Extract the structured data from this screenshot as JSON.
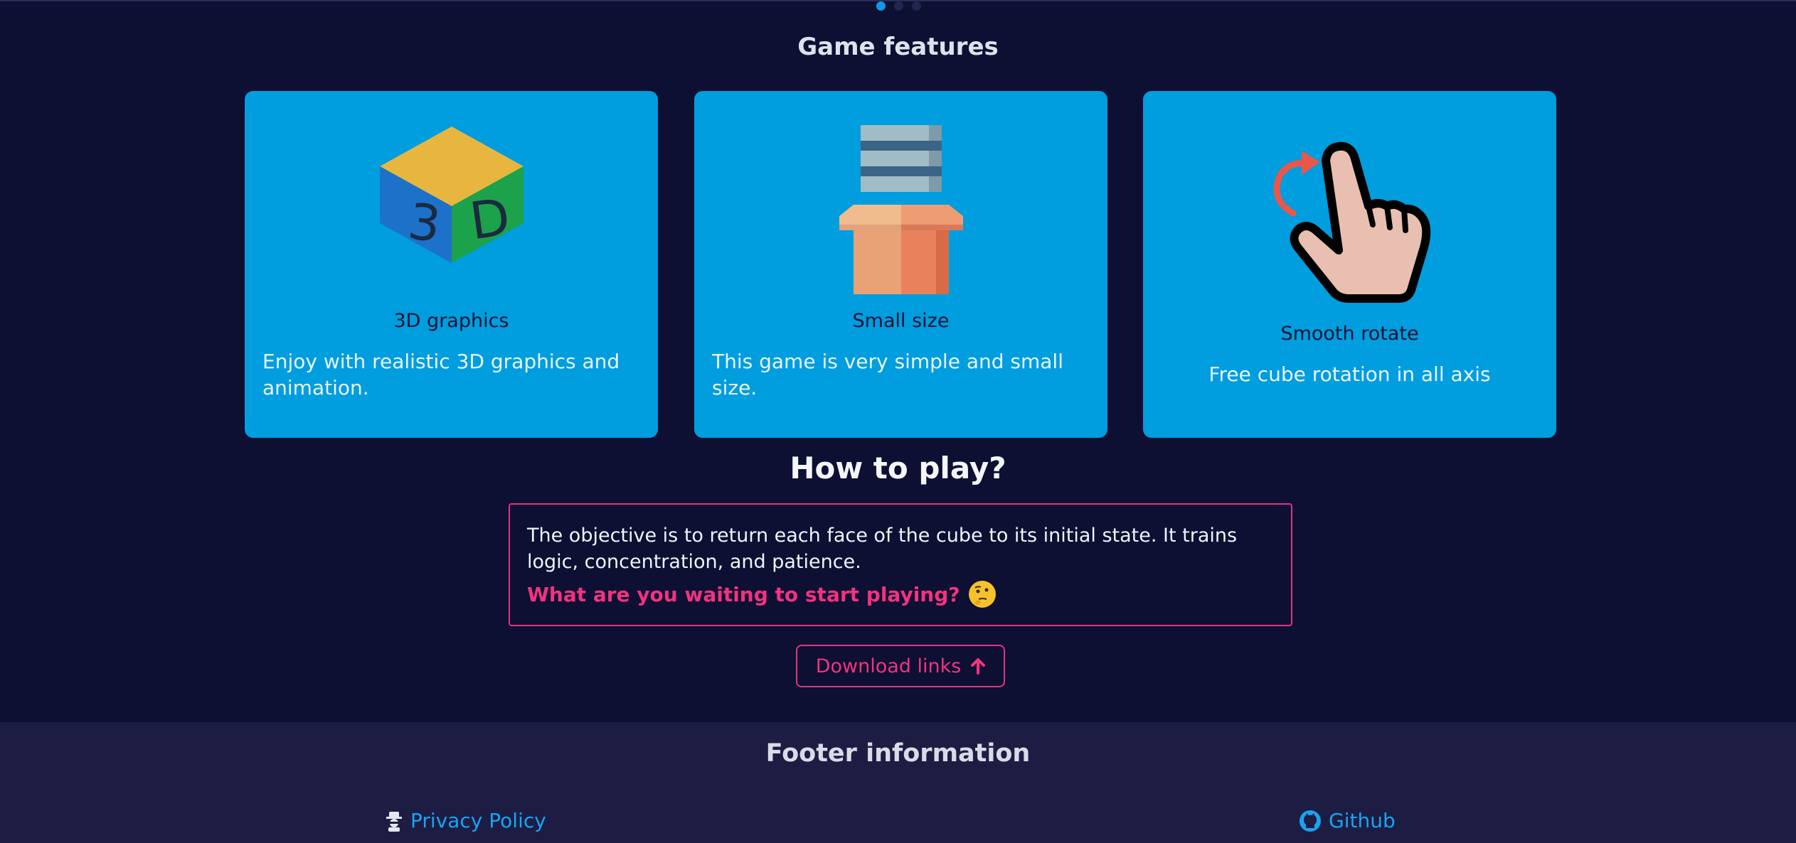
{
  "carousel": {
    "dots": 3,
    "active_index": 0
  },
  "features": {
    "title": "Game features",
    "cards": [
      {
        "icon": "3d-cube-icon",
        "title": "3D graphics",
        "description": "Enjoy with realistic 3D graphics and animation."
      },
      {
        "icon": "box-icon",
        "title": "Small size",
        "description": "This game is very simple and small size."
      },
      {
        "icon": "rotate-hand-icon",
        "title": "Smooth rotate",
        "description": "Free cube rotation in all axis"
      }
    ]
  },
  "howto": {
    "title": "How to play?",
    "text": "The objective is to return each face of the cube to its initial state. It trains logic, concentration, and patience.",
    "cta": "What are you waiting to start playing?",
    "cta_emoji": "thinking-face-icon"
  },
  "download": {
    "label": "Download links",
    "icon": "arrow-up-icon"
  },
  "footer": {
    "title": "Footer information",
    "links": [
      {
        "label": "Privacy Policy",
        "icon": "spy-icon"
      },
      {
        "label": "Github",
        "icon": "github-icon"
      }
    ]
  },
  "colors": {
    "background": "#0d0f33",
    "card": "#009ddf",
    "accent_pink": "#f2337f",
    "link_blue": "#1aa3f0",
    "footer_bg": "#1d1d44"
  }
}
